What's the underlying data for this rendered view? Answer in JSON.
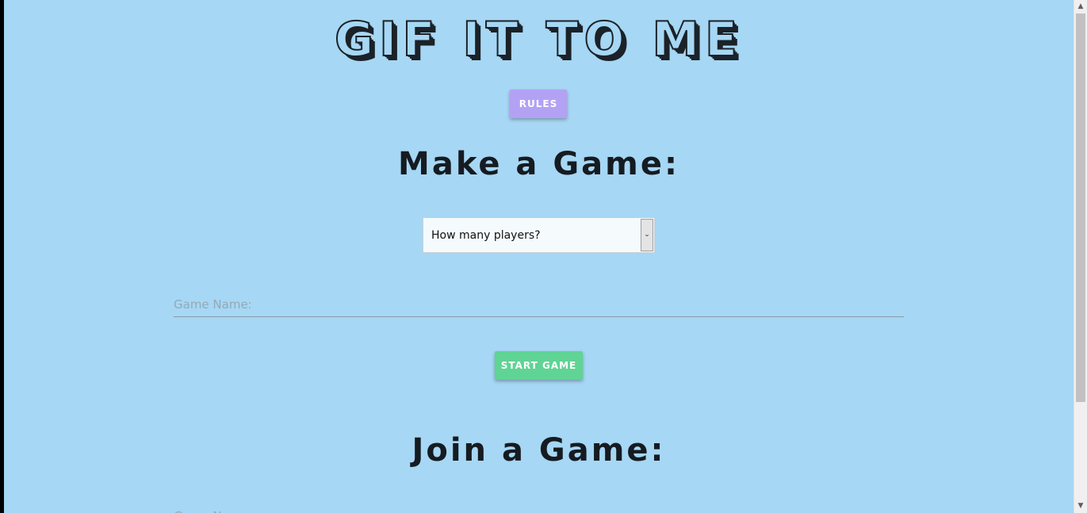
{
  "header": {
    "title": "GIF IT TO ME"
  },
  "buttons": {
    "rules_label": "RULES",
    "start_label": "START GAME"
  },
  "make_game": {
    "heading": "Make a Game:",
    "players_select": {
      "selected": "How many players?"
    },
    "game_name": {
      "placeholder": "Game Name:",
      "value": ""
    }
  },
  "join_game": {
    "heading": "Join a Game:",
    "game_name": {
      "placeholder": "Game Name:",
      "value": ""
    }
  },
  "colors": {
    "background": "#a6d7f4",
    "rules_button": "#b3a2f4",
    "start_button": "#5fd494",
    "text_dark": "#151b21"
  },
  "icons": {
    "select_arrow": "chevron-down-icon",
    "scroll_up": "scroll-up-arrow-icon",
    "scroll_down": "scroll-down-arrow-icon"
  }
}
